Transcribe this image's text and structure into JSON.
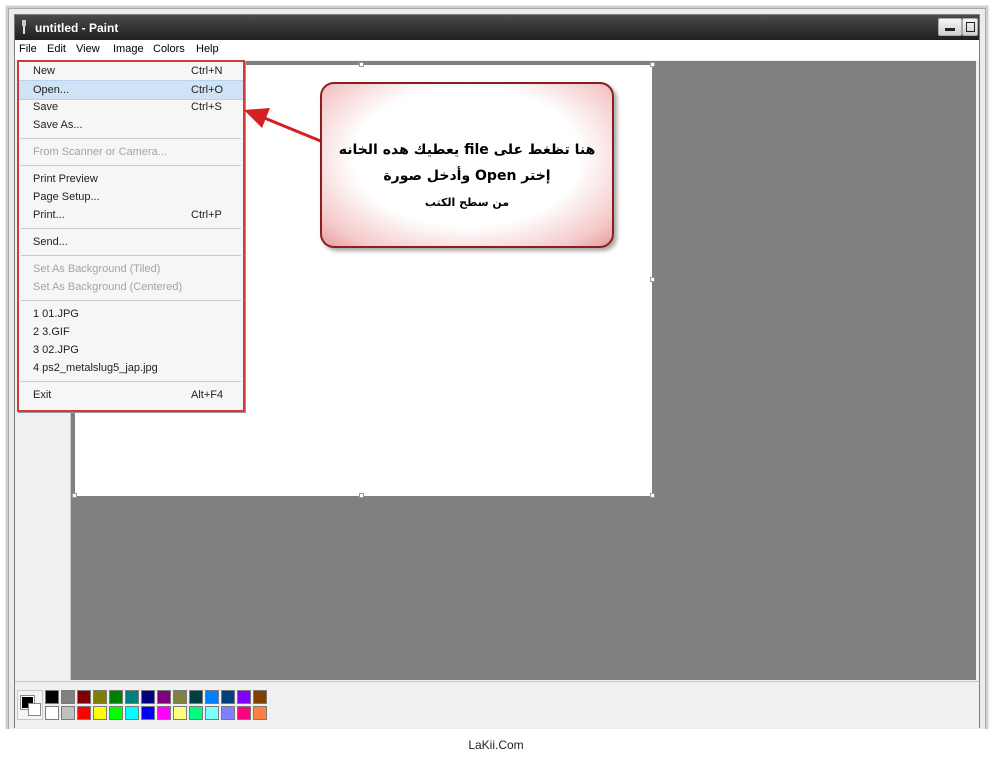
{
  "window": {
    "title": "untitled - Paint"
  },
  "menubar": {
    "items": [
      "File",
      "Edit",
      "View",
      "Image",
      "Colors",
      "Help"
    ]
  },
  "file_menu": {
    "items": [
      {
        "label": "New",
        "shortcut": "Ctrl+N",
        "disabled": false
      },
      {
        "label": "Open...",
        "shortcut": "Ctrl+O",
        "disabled": false,
        "highlighted": true
      },
      {
        "label": "Save",
        "shortcut": "Ctrl+S",
        "disabled": false
      },
      {
        "label": "Save As...",
        "shortcut": "",
        "disabled": false
      },
      {
        "label": "From Scanner or Camera...",
        "shortcut": "",
        "disabled": true
      },
      {
        "label": "Print Preview",
        "shortcut": "",
        "disabled": false
      },
      {
        "label": "Page Setup...",
        "shortcut": "",
        "disabled": false
      },
      {
        "label": "Print...",
        "shortcut": "Ctrl+P",
        "disabled": false
      },
      {
        "label": "Send...",
        "shortcut": "",
        "disabled": false
      },
      {
        "label": "Set As Background (Tiled)",
        "shortcut": "",
        "disabled": true
      },
      {
        "label": "Set As Background (Centered)",
        "shortcut": "",
        "disabled": true
      },
      {
        "label": "1 01.JPG",
        "shortcut": "",
        "disabled": false
      },
      {
        "label": "2 3.GIF",
        "shortcut": "",
        "disabled": false
      },
      {
        "label": "3 02.JPG",
        "shortcut": "",
        "disabled": false
      },
      {
        "label": "4 ps2_metalslug5_jap.jpg",
        "shortcut": "",
        "disabled": false
      },
      {
        "label": "Exit",
        "shortcut": "Alt+F4",
        "disabled": false
      }
    ]
  },
  "callout": {
    "line1": "هنا تظغط على file يعطيك هده الخانه",
    "line2": "إختر Open وأدخل صورة",
    "line3": "من سطح الكتب"
  },
  "palette": {
    "top_row": [
      "#000000",
      "#808080",
      "#800000",
      "#808000",
      "#008000",
      "#008080",
      "#000080",
      "#800080",
      "#808040",
      "#004040",
      "#0080ff",
      "#004080",
      "#8000ff",
      "#804000"
    ],
    "bottom_row": [
      "#ffffff",
      "#c0c0c0",
      "#ff0000",
      "#ffff00",
      "#00ff00",
      "#00ffff",
      "#0000ff",
      "#ff00ff",
      "#ffff80",
      "#00ff80",
      "#80ffff",
      "#8080ff",
      "#ff0080",
      "#ff8040"
    ]
  },
  "colors": {
    "accent_red": "#d13a3a",
    "highlight": "#cfe3f5",
    "workspace": "#808080"
  },
  "footer": {
    "brand": "LaKii.Com"
  }
}
